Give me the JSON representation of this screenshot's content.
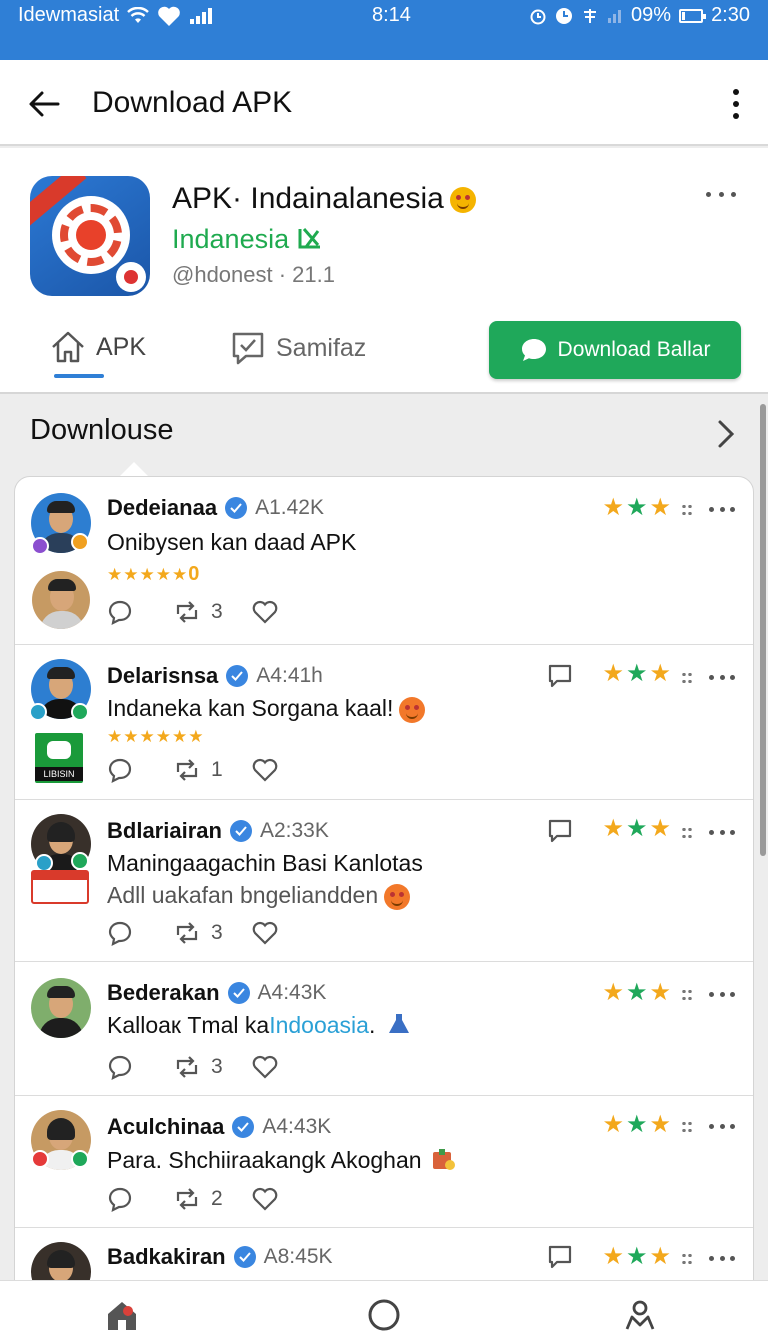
{
  "status_bar": {
    "carrier": "Idewmasiat",
    "clock": "8:14",
    "battery": "09%",
    "time_right": "2:30"
  },
  "header": {
    "title": "Download APK"
  },
  "app": {
    "name": "APK· Indainalanesia",
    "developer": "Indanesia",
    "meta": "@hdonest · 21.1",
    "tabs": [
      "APK",
      "Samifaz"
    ],
    "download_label": "Download Ballar"
  },
  "section": {
    "title": "Downlouse"
  },
  "posts": [
    {
      "name": "Dedeianaa",
      "handle": "A1.42K",
      "text": "Onibysen kan daad APK",
      "mini_stars": "★★★★★",
      "mini_stars_suffix": "0",
      "reply_count": "3",
      "rating_stars": 3
    },
    {
      "name": "Delarisnsa",
      "handle": "A4:41h",
      "text": "Indaneka kan Sorgana kaal!",
      "mini_stars": "★★★★★★",
      "reply_count": "1",
      "rating_stars": 3,
      "thumb_label": "LIBISIN"
    },
    {
      "name": "Bdlariairan",
      "handle": "A2:33K",
      "text": "Maningaagachin Basi Kanlotas",
      "subtext": "Adll uakafan bngeliandden",
      "reply_count": "3",
      "rating_stars": 3
    },
    {
      "name": "Bederakan",
      "handle": "A4:43K",
      "text_prefix": "Kalloaк Tmal ka",
      "text_highlight": "Indooasia",
      "text_suffix": ".",
      "reply_count": "3",
      "rating_stars": 3
    },
    {
      "name": "Aculchinaa",
      "handle": "A4:43K",
      "text": "Para. Shchiiraakangk Akoghan",
      "reply_count": "2",
      "rating_stars": 3
    },
    {
      "name": "Badkakiran",
      "handle": "A8:45K",
      "rating_stars": 3
    }
  ],
  "colors": {
    "status_bar": "#2f7fd6",
    "accent_blue": "#2f7fd6",
    "download_green": "#1fa85a",
    "developer_green": "#1faa4f",
    "star_yellow": "#f3a81c",
    "star_green": "#1fa85a",
    "verified_blue": "#3a86e0"
  },
  "icons": {
    "back": "arrow-left-icon",
    "more": "more-vertical-icon",
    "home": "home-icon",
    "reply": "reply-icon",
    "repost": "repost-icon",
    "like": "heart-icon",
    "comment": "comment-icon"
  }
}
